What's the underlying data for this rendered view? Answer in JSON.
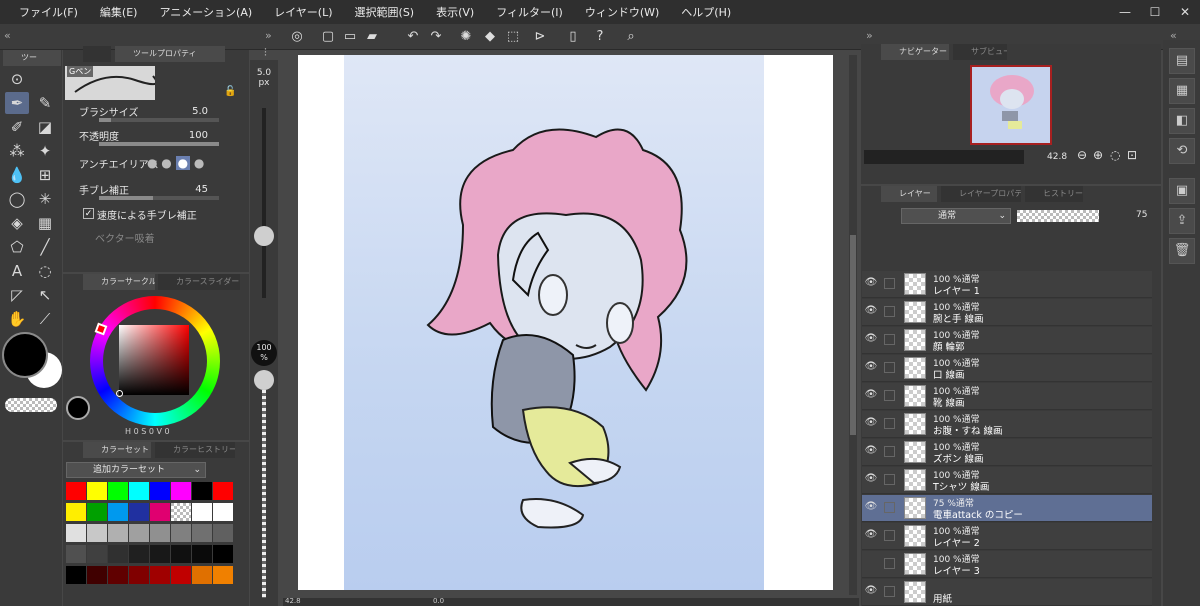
{
  "menu": [
    "ファイル(F)",
    "編集(E)",
    "アニメーション(A)",
    "レイヤー(L)",
    "選択範囲(S)",
    "表示(V)",
    "フィルター(I)",
    "ウィンドウ(W)",
    "ヘルプ(H)"
  ],
  "tool_tab": "ツー",
  "subtool": {
    "tab_label": "ツールプロパティ",
    "brush_name": "Gペン",
    "props": {
      "brush_size": {
        "label": "ブラシサイズ",
        "value": "5.0"
      },
      "opacity": {
        "label": "不透明度",
        "value": "100"
      },
      "antialias": {
        "label": "アンチエイリアス"
      },
      "stabilization": {
        "label": "手ブレ補正",
        "value": "45"
      },
      "speed_stab": {
        "label": "速度による手ブレ補正"
      },
      "vector_snap": {
        "label": "ベクター吸着"
      }
    }
  },
  "brush_size_indicator": {
    "value": "5.0",
    "unit": "px"
  },
  "opacity_indicator": {
    "value": "100",
    "unit": "%"
  },
  "color_panel": {
    "tab1": "カラーサークル",
    "tab2": "カラースライダー",
    "hsv": {
      "h": "H",
      "h_val": "0",
      "s": "S",
      "s_val": "0",
      "v": "V",
      "v_val": "0"
    }
  },
  "color_set": {
    "tab1": "カラーセット",
    "tab2": "カラーヒストリー",
    "set_name": "追加カラーセット",
    "swatches": [
      "#ff0000",
      "#ffff00",
      "#00ff00",
      "#00ffff",
      "#0000ff",
      "#ff00ff",
      "#000000",
      "#ff0000",
      "#ffee00",
      "#00a000",
      "#0099ee",
      "#2030a0",
      "#e00070",
      "checker",
      "#ffffff",
      "#ffffff",
      "#e0e0e0",
      "#c8c8c8",
      "#b0b0b0",
      "#a0a0a0",
      "#909090",
      "#808080",
      "#707070",
      "#606060",
      "#505050",
      "#404040",
      "#303030",
      "#202020",
      "#181818",
      "#101010",
      "#0a0a0a",
      "#000000",
      "#000000",
      "#400000",
      "#600000",
      "#800000",
      "#a00000",
      "#c00000",
      "#e07000",
      "#f08000"
    ]
  },
  "navigator": {
    "tab1": "ナビゲーター",
    "tab2": "サブビュー",
    "zoom": "42.8"
  },
  "layer_panel": {
    "tab1": "レイヤー",
    "tab2": "レイヤープロパティ",
    "tab3": "ヒストリー",
    "blend_mode": "通常",
    "opacity": "75",
    "layers": [
      {
        "meta": "100 %通常",
        "name": "レイヤー 1",
        "visible": true,
        "selected": false
      },
      {
        "meta": "100 %通常",
        "name": "腕と手  線画",
        "visible": true,
        "selected": false
      },
      {
        "meta": "100 %通常",
        "name": "顔  輪郭",
        "visible": true,
        "selected": false
      },
      {
        "meta": "100 %通常",
        "name": "口  線画",
        "visible": true,
        "selected": false
      },
      {
        "meta": "100 %通常",
        "name": "靴  線画",
        "visible": true,
        "selected": false
      },
      {
        "meta": "100 %通常",
        "name": "お腹・すね  線画",
        "visible": true,
        "selected": false
      },
      {
        "meta": "100 %通常",
        "name": "ズボン  線画",
        "visible": true,
        "selected": false
      },
      {
        "meta": "100 %通常",
        "name": "Tシャツ  線画",
        "visible": true,
        "selected": false
      },
      {
        "meta": "75 %通常",
        "name": "電車attack のコピー",
        "visible": true,
        "selected": true
      },
      {
        "meta": "100 %通常",
        "name": "レイヤー 2",
        "visible": true,
        "selected": false
      },
      {
        "meta": "100 %通常",
        "name": "レイヤー 3",
        "visible": false,
        "selected": false
      },
      {
        "meta": "",
        "name": "用紙",
        "visible": true,
        "selected": false
      }
    ]
  },
  "status": {
    "zoom": "42.8",
    "angle": "0.0"
  }
}
